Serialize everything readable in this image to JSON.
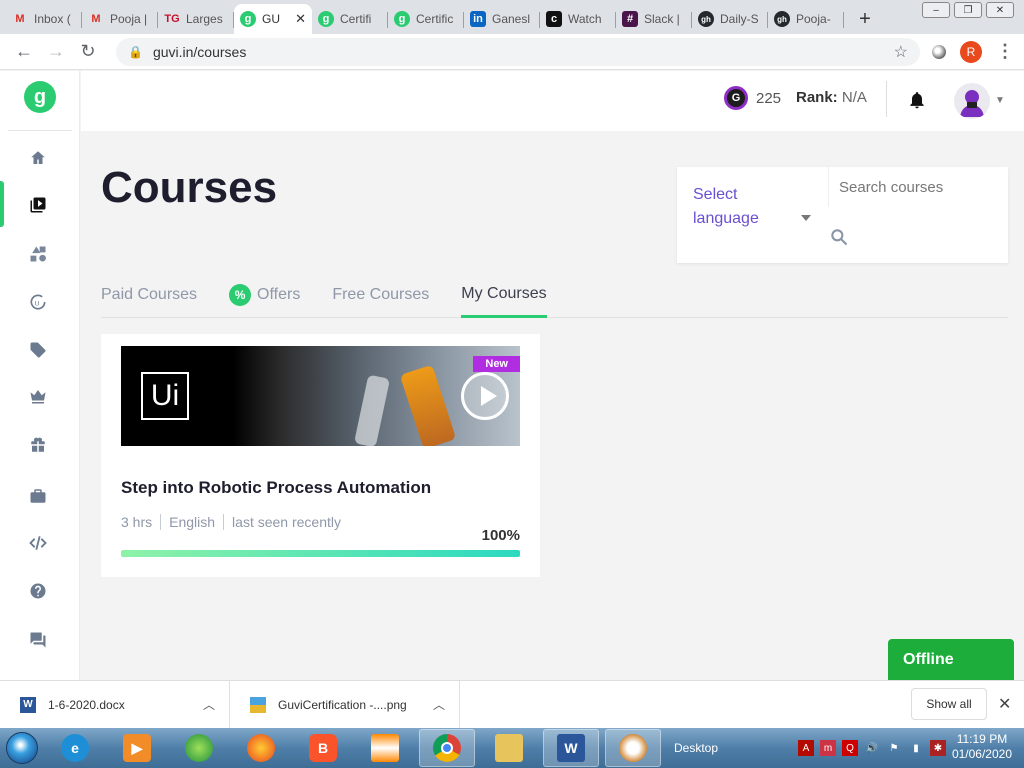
{
  "browser": {
    "tabs": [
      {
        "title": "Inbox (",
        "icon": "M",
        "color": "#d93025"
      },
      {
        "title": "Pooja |",
        "icon": "M",
        "color": "#d93025"
      },
      {
        "title": "Larges",
        "icon": "TG",
        "color": "#c8102e"
      },
      {
        "title": "GU",
        "icon": "g",
        "color": "#2bcc71",
        "active": true
      },
      {
        "title": "Certifi",
        "icon": "g",
        "color": "#2bcc71"
      },
      {
        "title": "Certific",
        "icon": "g",
        "color": "#2bcc71"
      },
      {
        "title": "Ganesl",
        "icon": "in",
        "color": "#0a66c2"
      },
      {
        "title": "Watch",
        "icon": "c",
        "color": "#111"
      },
      {
        "title": "Slack |",
        "icon": "#",
        "color": "#4a154b"
      },
      {
        "title": "Daily-S",
        "icon": "gh",
        "color": "#24292e"
      },
      {
        "title": "Pooja-",
        "icon": "gh",
        "color": "#24292e"
      }
    ],
    "new_tab": "+",
    "url": "guvi.in/courses",
    "profile_initial": "R"
  },
  "header": {
    "gems_icon": "G",
    "gems": "225",
    "rank_label": "Rank:",
    "rank_value": "N/A"
  },
  "sidebar": {
    "logo": "g",
    "items": [
      "home",
      "courses",
      "practice",
      "ide",
      "tags",
      "premium",
      "rewards",
      "jobs",
      "code",
      "help",
      "forum"
    ]
  },
  "main": {
    "title": "Courses",
    "language_select": "Select language",
    "search_placeholder": "Search courses",
    "tabs": {
      "paid": "Paid Courses",
      "offer_badge": "%",
      "offers": "Offers",
      "free": "Free Courses",
      "mine": "My Courses"
    },
    "course": {
      "logo_text": "Ui",
      "badge": "New",
      "title": "Step into Robotic Process Automation",
      "duration": "3 hrs",
      "language": "English",
      "last_seen": "last seen recently",
      "progress_label": "100%",
      "progress": 1.0
    },
    "offline_label": "Offline"
  },
  "downloads": {
    "items": [
      {
        "name": "1-6-2020.docx",
        "icon": "W"
      },
      {
        "name": "GuviCertification -....png",
        "icon": "img"
      }
    ],
    "show_all": "Show all"
  },
  "taskbar": {
    "desktop_label": "Desktop",
    "time": "11:19 PM",
    "date": "01/06/2020"
  },
  "colors": {
    "accent": "#2bcc71",
    "link_purple": "#6a4fd0",
    "new_badge": "#b12de2",
    "offline_green": "#1cad3b"
  }
}
